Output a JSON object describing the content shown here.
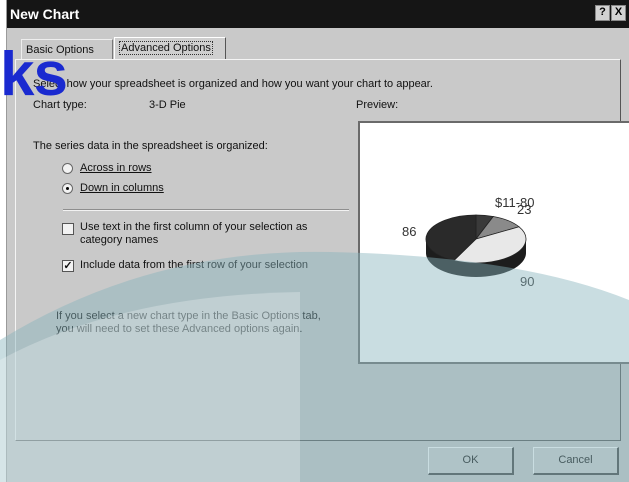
{
  "window": {
    "title": "New Chart",
    "help_label": "?",
    "close_label": "X"
  },
  "tabs": [
    {
      "label": "Basic Options"
    },
    {
      "label": "Advanced Options"
    }
  ],
  "intro": {
    "text": "Select how your spreadsheet is organized and how you want your chart to appear."
  },
  "chart_type": {
    "label": "Chart type:",
    "value": "3-D Pie"
  },
  "preview_label": "Preview:",
  "series": {
    "label": "The series data in the spreadsheet is organized:",
    "options": [
      {
        "label": "Across in rows",
        "selected": false
      },
      {
        "label": "Down in columns",
        "selected": true
      }
    ]
  },
  "checks": [
    {
      "line1": "Use text in the first column of your selection as",
      "line2": "category names",
      "checked": false
    },
    {
      "line1": "Include data from the first row of your selection",
      "checked": true
    }
  ],
  "note": {
    "line1": "If you select a new chart type in the Basic Options tab,",
    "line2": "you will need to set these Advanced options again."
  },
  "buttons": {
    "ok": "OK",
    "cancel": "Cancel"
  },
  "watermark": "ks",
  "chart_data": {
    "type": "pie",
    "labels": [
      "$11-80",
      "23",
      "86",
      "90"
    ],
    "values": [
      11.8,
      23,
      86,
      90
    ],
    "colors": [
      "#3a3a3a",
      "#8a8a8a",
      "#e8e8e8",
      "#2a2a2a"
    ]
  },
  "colors": {
    "background_band": "#88b3bd"
  }
}
